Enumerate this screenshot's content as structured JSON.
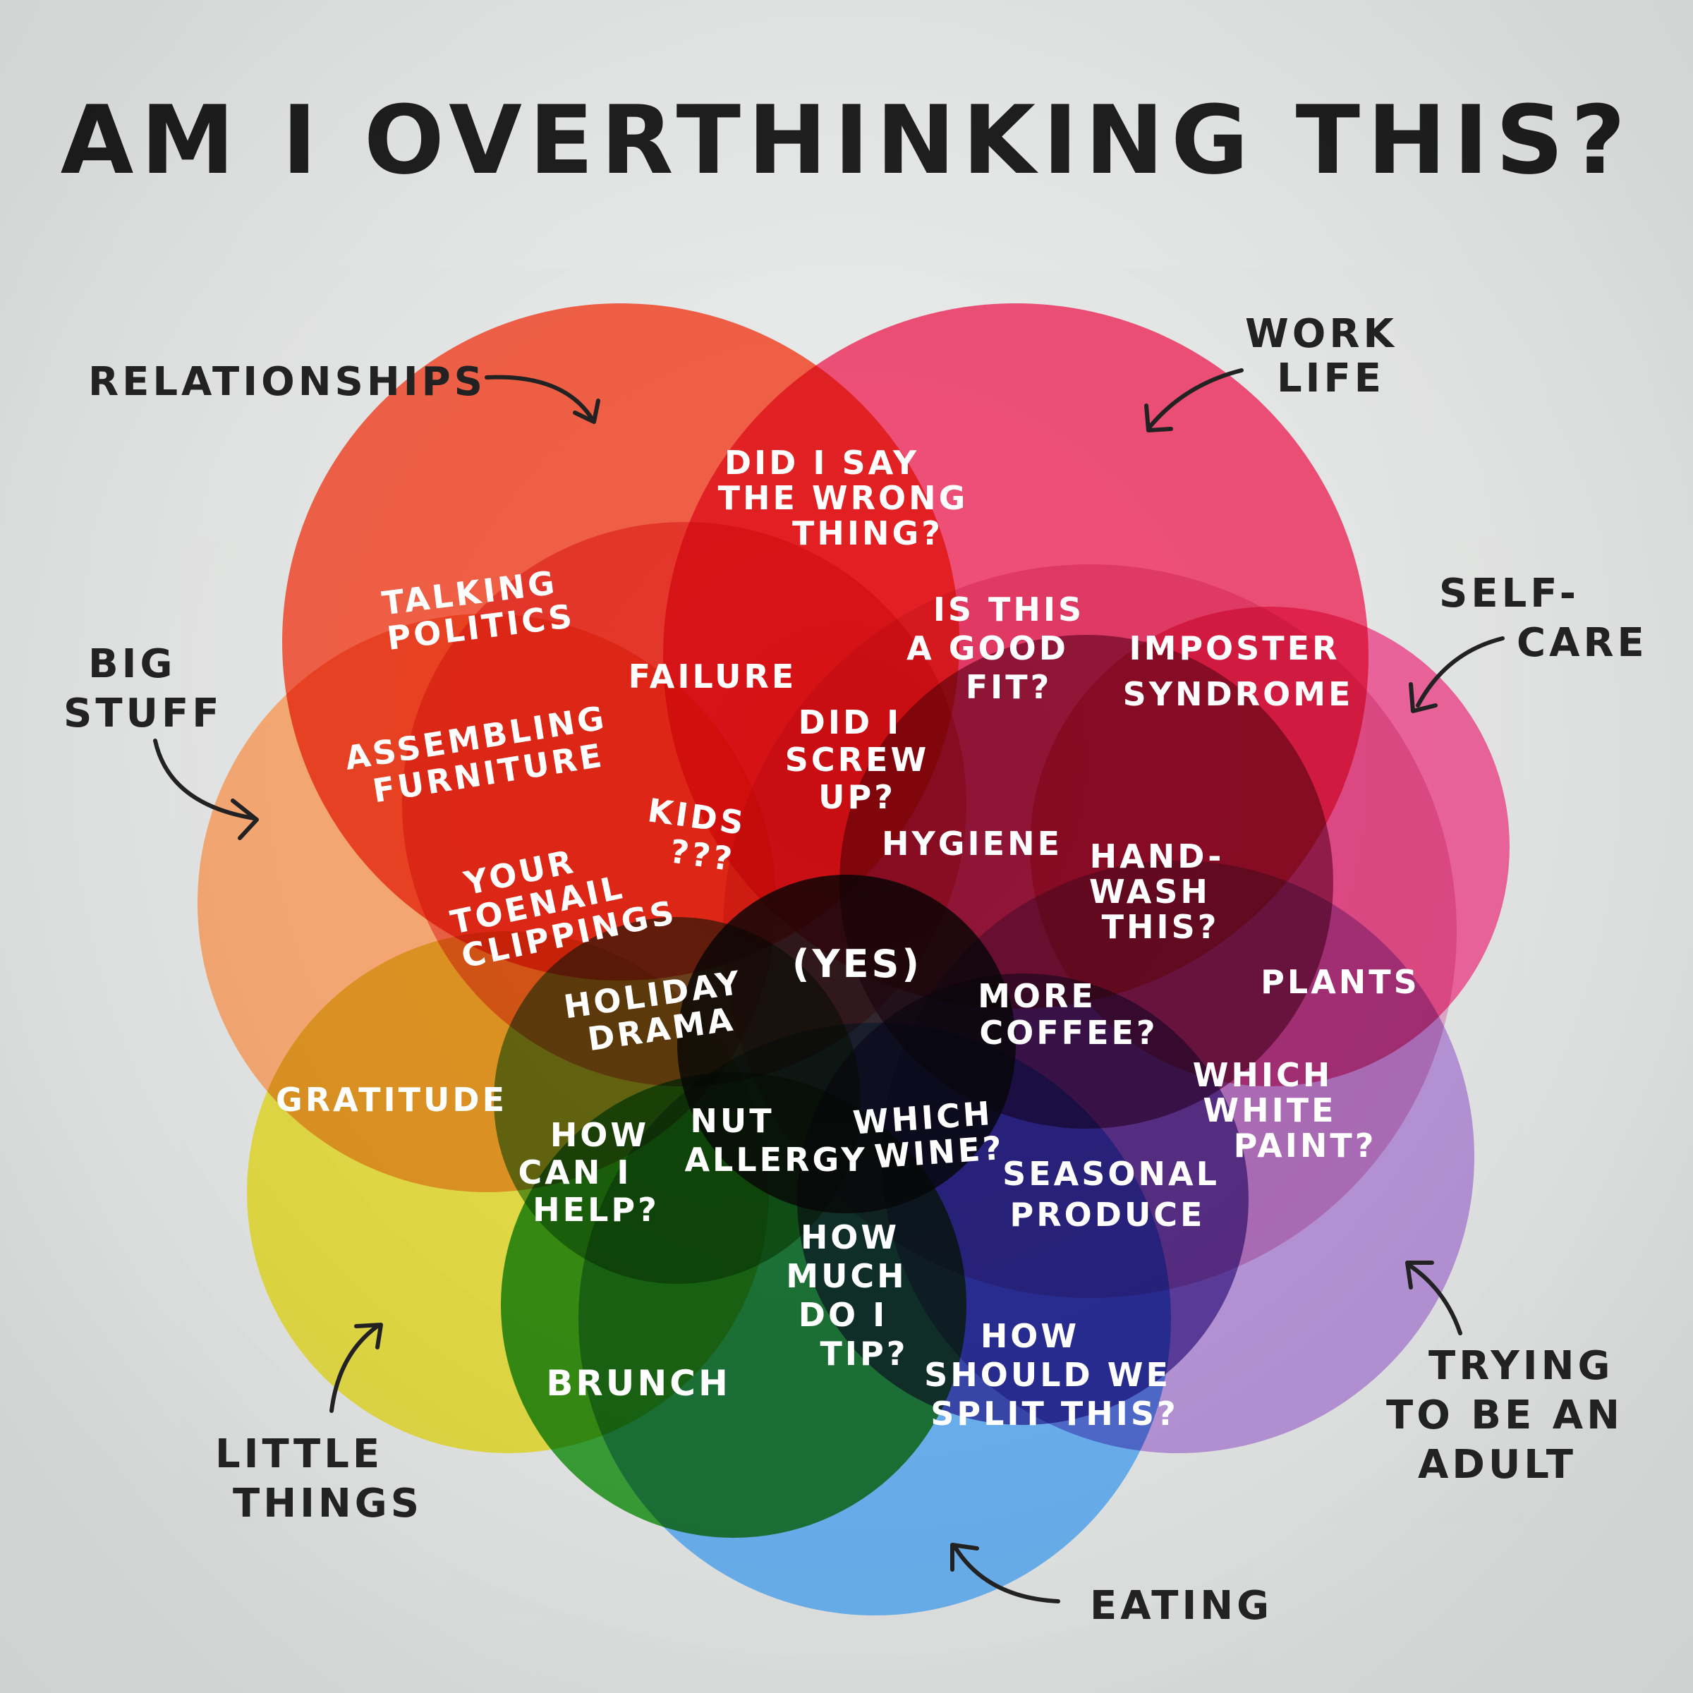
{
  "title": "AM I OVERTHINKING THIS?",
  "categories": {
    "relationships": "RELATIONSHIPS",
    "work_life": [
      "WORK",
      "LIFE"
    ],
    "self_care": [
      "SELF-",
      "CARE"
    ],
    "big_stuff": [
      "BIG",
      "STUFF"
    ],
    "little_things": [
      "LITTLE",
      "THINGS"
    ],
    "eating": "EATING",
    "trying_adult": [
      "TRYING",
      "TO BE AN",
      "ADULT"
    ]
  },
  "regions": {
    "did_i_say": [
      "DID I SAY",
      "THE WRONG",
      "THING?"
    ],
    "talking_politics": [
      "TALKING",
      "POLITICS"
    ],
    "failure": "FAILURE",
    "is_this_fit": [
      "IS THIS",
      "A GOOD",
      "FIT?"
    ],
    "imposter": [
      "IMPOSTER",
      "SYNDROME"
    ],
    "assembling": [
      "ASSEMBLING",
      "FURNITURE"
    ],
    "did_i_screw": [
      "DID I",
      "SCREW",
      "UP?"
    ],
    "kids": [
      "KIDS",
      "???"
    ],
    "hygiene": "HYGIENE",
    "hand_wash": [
      "HAND-",
      "WASH",
      "THIS?"
    ],
    "toenail": [
      "YOUR",
      "TOENAIL",
      "CLIPPINGS"
    ],
    "yes": "(YES)",
    "holiday": [
      "HOLIDAY",
      "DRAMA"
    ],
    "more_coffee": [
      "MORE",
      "COFFEE?"
    ],
    "plants": "PLANTS",
    "gratitude": "GRATITUDE",
    "how_help": [
      "HOW",
      "CAN I",
      "HELP?"
    ],
    "nut_allergy": [
      "NUT",
      "ALLERGY"
    ],
    "which_wine": [
      "WHICH",
      "WINE?"
    ],
    "which_paint": [
      "WHICH",
      "WHITE",
      "PAINT?"
    ],
    "seasonal": [
      "SEASONAL",
      "PRODUCE"
    ],
    "tip": [
      "HOW",
      "MUCH",
      "DO I",
      "TIP?"
    ],
    "brunch": "BRUNCH",
    "split": [
      "HOW",
      "SHOULD WE",
      "SPLIT THIS?"
    ]
  },
  "colors": {
    "relationships": "#f0553a",
    "work_life": "#ee3f6a",
    "self_care": "#ec4a8c",
    "big_stuff": "#f7a36a",
    "little_things": "#e3d93a",
    "eating": "#62aef0",
    "trying_adult": "#b38ed6",
    "center": "#111111"
  }
}
